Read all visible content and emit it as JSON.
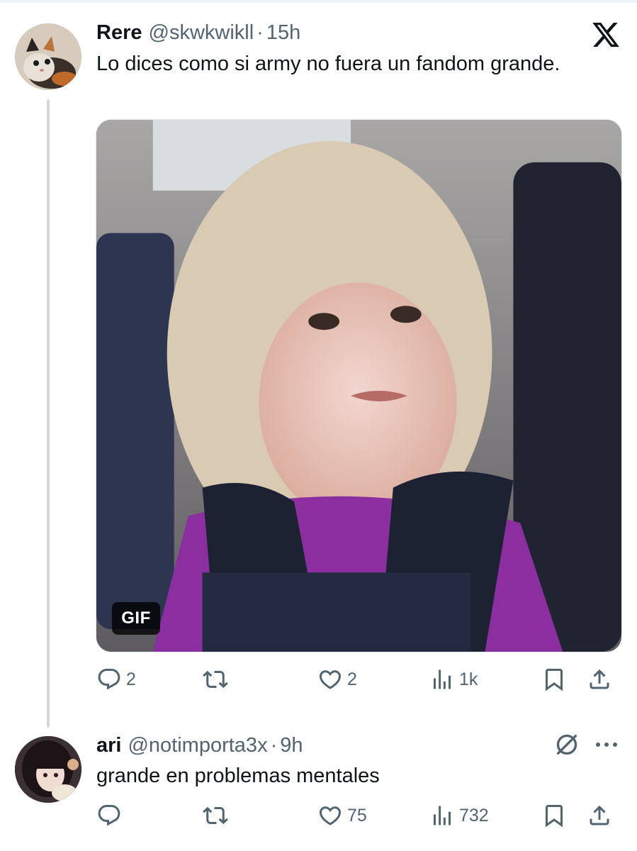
{
  "tweets": [
    {
      "display_name": "Rere",
      "handle": "@skwkwikll",
      "separator": "·",
      "time": "15h",
      "text": "Lo dices como si army no fuera un fandom grande.",
      "media": {
        "badge": "GIF"
      },
      "actions": {
        "replies": "2",
        "retweets": "",
        "likes": "2",
        "views": "1k"
      }
    },
    {
      "display_name": "ari",
      "handle": "@notimporta3x",
      "separator": "·",
      "time": "9h",
      "text": "grande en problemas mentales",
      "actions": {
        "replies": "",
        "retweets": "",
        "likes": "75",
        "views": "732"
      }
    }
  ],
  "colors": {
    "text_primary": "#0f1419",
    "text_secondary": "#536471",
    "thread_line": "#cfd9de"
  },
  "icons": [
    "x-logo",
    "reply-icon",
    "retweet-icon",
    "like-icon",
    "views-icon",
    "bookmark-icon",
    "share-icon",
    "muted-icon",
    "more-icon"
  ]
}
